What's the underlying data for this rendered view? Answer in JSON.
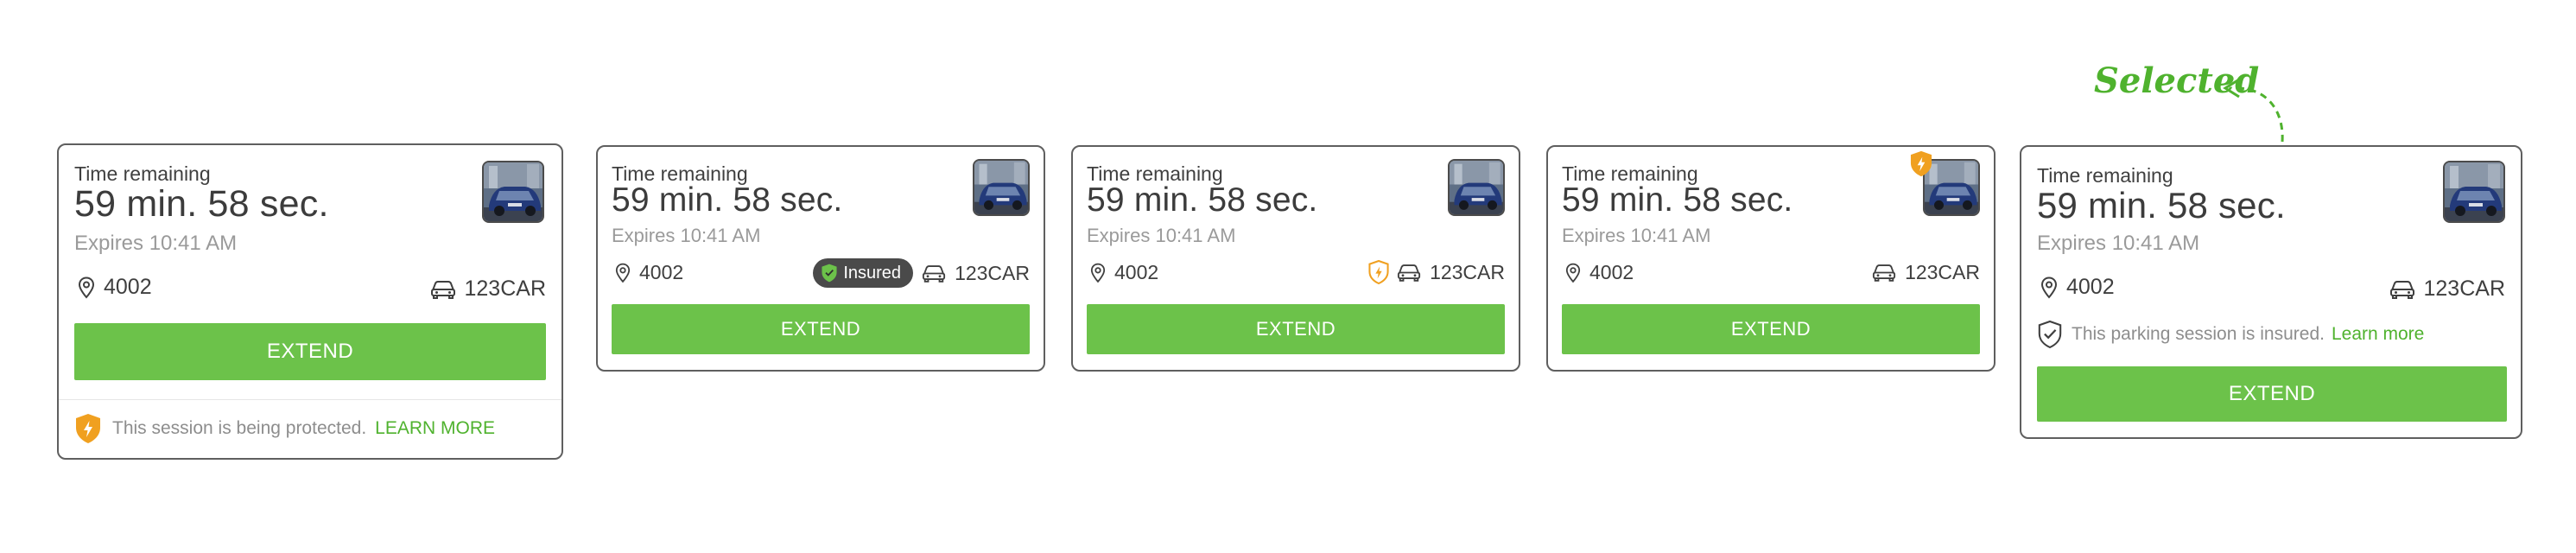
{
  "annotation": {
    "selected_label": "Selected"
  },
  "card1": {
    "time_label": "Time remaining",
    "time_value": "59 min. 58 sec.",
    "expires": "Expires 10:41 AM",
    "zone": "4002",
    "plate": "123CAR",
    "button": "EXTEND",
    "footer_text": "This session is being protected.",
    "footer_link": "LEARN MORE"
  },
  "card2": {
    "time_label": "Time remaining",
    "time_value": "59 min. 58 sec.",
    "expires": "Expires 10:41 AM",
    "zone": "4002",
    "badge": "Insured",
    "plate": "123CAR",
    "button": "EXTEND"
  },
  "card3": {
    "time_label": "Time remaining",
    "time_value": "59 min. 58 sec.",
    "expires": "Expires 10:41 AM",
    "zone": "4002",
    "plate": "123CAR",
    "button": "EXTEND"
  },
  "card4": {
    "time_label": "Time remaining",
    "time_value": "59 min. 58 sec.",
    "expires": "Expires 10:41 AM",
    "zone": "4002",
    "plate": "123CAR",
    "button": "EXTEND"
  },
  "card5": {
    "time_label": "Time remaining",
    "time_value": "59 min. 58 sec.",
    "expires": "Expires 10:41 AM",
    "zone": "4002",
    "plate": "123CAR",
    "insured_text": "This parking session is insured.",
    "insured_link": "Learn more",
    "button": "EXTEND"
  },
  "colors": {
    "accent_green": "#6cc24a",
    "link_green": "#4fb22e",
    "shield_orange": "#f0a020",
    "badge_dark": "#4a4a4a"
  },
  "icons": [
    "location-pin-icon",
    "car-icon",
    "shield-bolt-icon",
    "shield-check-icon",
    "vehicle-photo"
  ]
}
